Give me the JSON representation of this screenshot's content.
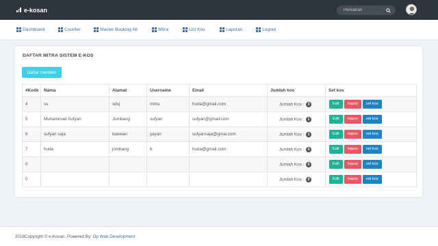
{
  "header": {
    "brand": "e-kosan",
    "search_placeholder": "Pencarian",
    "icons": {
      "brand": "bar-chart-icon",
      "search": "search-icon",
      "avatar": "user-avatar"
    }
  },
  "nav": {
    "items": [
      {
        "label": "Dashboard",
        "icon": "grid-icon"
      },
      {
        "label": "Counter",
        "icon": "grid-icon"
      },
      {
        "label": "Master Booking All",
        "icon": "grid-icon"
      },
      {
        "label": "Mitra",
        "icon": "grid-icon"
      },
      {
        "label": "List Kos",
        "icon": "grid-icon"
      },
      {
        "label": "Laporan",
        "icon": "grid-icon"
      },
      {
        "label": "Logout",
        "icon": "grid-icon"
      }
    ]
  },
  "main": {
    "title": "DAFTAR MITRA SISTEM E-KOS",
    "add_button": "Daftar member",
    "table": {
      "headers": [
        "#Kode",
        "Nama",
        "Alamat",
        "Username",
        "Email",
        "Jumlah kos",
        "Set kos"
      ],
      "jumlah_label": "Jumlah Kos :",
      "actions": {
        "edit": "Edit",
        "hapus": "hapus",
        "setkos": "set kos"
      },
      "rows": [
        {
          "kode": "4",
          "nama": "ss",
          "alamat": "sdsj",
          "username": "mitra",
          "email": "huda@gmail.com",
          "jumlah": "3"
        },
        {
          "kode": "5",
          "nama": "Muhammad Sufyan",
          "alamat": "Jombang",
          "username": "sufyan",
          "email": "sufyan@gmail.com",
          "jumlah": "1"
        },
        {
          "kode": "6",
          "nama": "sufyan saja",
          "alamat": "bawean",
          "username": "yayan",
          "email": "sufyansaja@gmai.com",
          "jumlah": "1"
        },
        {
          "kode": "7",
          "nama": "huda",
          "alamat": "jombang",
          "username": "b",
          "email": "huda@gmail.com",
          "jumlah": "0"
        },
        {
          "kode": "0",
          "nama": "",
          "alamat": "",
          "username": "",
          "email": "",
          "jumlah": "0"
        },
        {
          "kode": "0",
          "nama": "",
          "alamat": "",
          "username": "",
          "email": "",
          "jumlah": "0"
        }
      ]
    }
  },
  "footer": {
    "text": "2018Copyright © e-Kosan. Powered By: ",
    "link": "Op Web Development"
  },
  "colors": {
    "topbar": "#2f353d",
    "nav_link": "#3a6ea5",
    "add_button": "#3fd0e8",
    "edit": "#1ab394",
    "hapus": "#ed5565",
    "setkos": "#1c84c6"
  }
}
